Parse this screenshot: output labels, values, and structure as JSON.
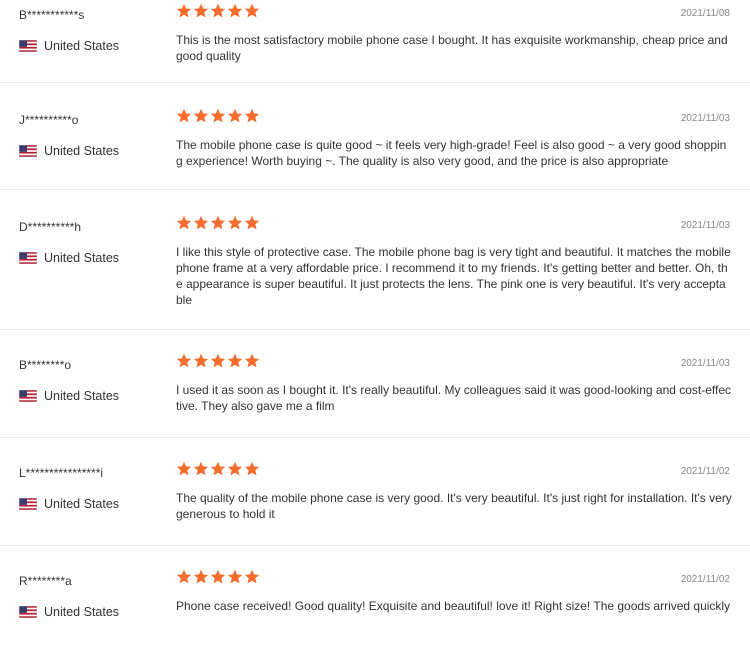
{
  "colors": {
    "star": "#f56c2d",
    "divider": "#e8e8e8"
  },
  "reviews": [
    {
      "user": "B***********s",
      "country": "United States",
      "rating": 5,
      "date": "2021/11/08",
      "text": "This is the most satisfactory mobile phone case I bought. It has exquisite workmanship, cheap price and good quality"
    },
    {
      "user": "J**********o",
      "country": "United States",
      "rating": 5,
      "date": "2021/11/03",
      "text": "The mobile phone case is quite good ~ it feels very high-grade! Feel is also good ~ a very good shopping experience! Worth buying ~. The quality is also very good, and the price is also appropriate"
    },
    {
      "user": "D**********h",
      "country": "United States",
      "rating": 5,
      "date": "2021/11/03",
      "text": "I like this style of protective case. The mobile phone bag is very tight and beautiful. It matches the mobile phone frame at a very affordable price. I recommend it to my friends. It's getting better and better. Oh, the appearance is super beautiful. It just protects the lens. The pink one is very beautiful. It's very acceptable"
    },
    {
      "user": "B********o",
      "country": "United States",
      "rating": 5,
      "date": "2021/11/03",
      "text": "I used it as soon as I bought it. It's really beautiful. My colleagues said it was good-looking and cost-effective. They also gave me a film"
    },
    {
      "user": "L****************i",
      "country": "United States",
      "rating": 5,
      "date": "2021/11/02",
      "text": "The quality of the mobile phone case is very good. It's very beautiful. It's just right for installation. It's very generous to hold it"
    },
    {
      "user": "R********a",
      "country": "United States",
      "rating": 5,
      "date": "2021/11/02",
      "text": "Phone case received! Good quality! Exquisite and beautiful! love it! Right size! The goods arrived quickly"
    }
  ]
}
